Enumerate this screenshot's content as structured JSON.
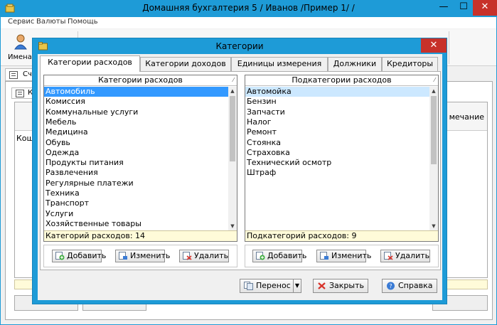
{
  "main_window": {
    "title": "Домашняя бухгалтерия 5  / Иванов /Пример 1/ /",
    "menu": [
      "Сервис",
      "Валюты",
      "Помощь"
    ],
    "toolbar_button_label": "Имена",
    "tab_partial_label": "Сч",
    "inner_tab_partial_label": "К",
    "column_partial_label": "мечание",
    "row_partial_label": "Кош",
    "window_controls": {
      "minimize": "—",
      "maximize": "☐",
      "close": "✕"
    }
  },
  "dialog": {
    "title": "Категории",
    "close_glyph": "✕",
    "tabs": [
      {
        "label": "Категории расходов",
        "active": true
      },
      {
        "label": "Категории доходов",
        "active": false
      },
      {
        "label": "Единицы измерения",
        "active": false
      },
      {
        "label": "Должники",
        "active": false
      },
      {
        "label": "Кредиторы",
        "active": false
      }
    ],
    "left_list": {
      "header": "Категории расходов",
      "sort_glyph": "⁄",
      "items": [
        "Автомобиль",
        "Комиссия",
        "Коммунальные услуги",
        "Мебель",
        "Медицина",
        "Обувь",
        "Одежда",
        "Продукты питания",
        "Развлечения",
        "Регулярные платежи",
        "Техника",
        "Транспорт",
        "Услуги",
        "Хозяйственные товары"
      ],
      "selected_index": 0,
      "footer": "Категорий расходов: 14",
      "buttons": {
        "add": "Добавить",
        "edit": "Изменить",
        "delete": "Удалить"
      }
    },
    "right_list": {
      "header": "Подкатегории расходов",
      "sort_glyph": "⁄",
      "items": [
        "Автомойка",
        "Бензин",
        "Запчасти",
        "Налог",
        "Ремонт",
        "Стоянка",
        "Страховка",
        "Технический осмотр",
        "Штраф"
      ],
      "selected_index": 0,
      "footer": "Подкатегорий расходов: 9",
      "buttons": {
        "add": "Добавить",
        "edit": "Изменить",
        "delete": "Удалить"
      }
    },
    "footer_buttons": {
      "transfer": "Перенос",
      "close": "Закрыть",
      "help": "Справка"
    }
  },
  "icons": {
    "add": "add-row-icon",
    "edit": "edit-row-icon",
    "delete": "delete-row-icon",
    "transfer": "transfer-icon",
    "close": "close-x-icon",
    "help": "help-icon"
  },
  "colors": {
    "title_bar": "#1e9bd7",
    "close_button": "#c7312a",
    "selection": "#3399ff",
    "selection_light": "#cce8ff",
    "footer_highlight": "#fffbd9"
  }
}
